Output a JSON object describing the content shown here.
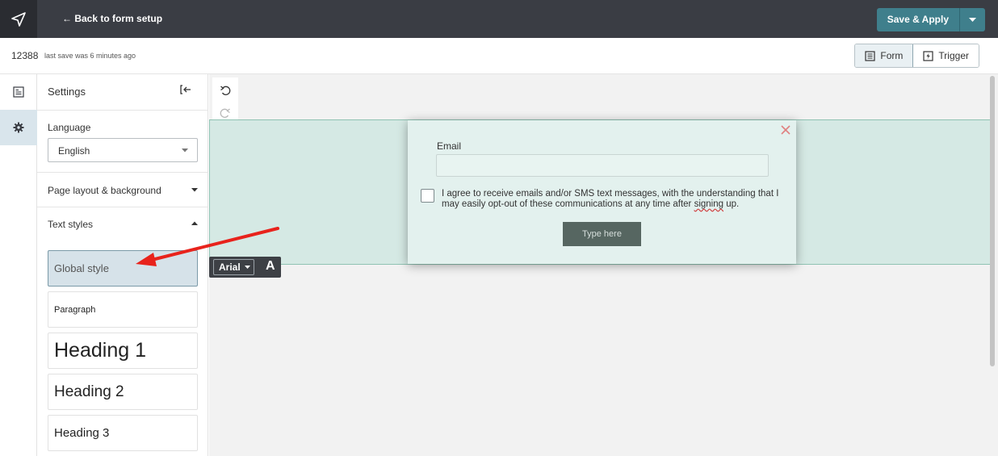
{
  "topbar": {
    "logo_icon": "paper-plane-icon",
    "back_label": "← Back to form setup",
    "save_label": "Save & Apply",
    "save_color": "#3f7f8c"
  },
  "status": {
    "form_id": "12388",
    "save_note": "last save was 6 minutes ago",
    "toggle": [
      {
        "label": "Form",
        "icon": "form-icon",
        "active": true
      },
      {
        "label": "Trigger",
        "icon": "trigger-icon",
        "active": false
      }
    ]
  },
  "rail": {
    "items": [
      {
        "icon": "form-list-icon",
        "active": false
      },
      {
        "icon": "gear-icon",
        "active": true
      }
    ]
  },
  "settings": {
    "title": "Settings",
    "language_label": "Language",
    "language_value": "English",
    "page_layout_label": "Page layout & background",
    "text_styles_label": "Text styles",
    "styles": [
      {
        "label": "Global style",
        "selected": true
      },
      {
        "label": "Paragraph",
        "selected": false
      },
      {
        "label": "Heading 1",
        "selected": false
      },
      {
        "label": "Heading 2",
        "selected": false
      },
      {
        "label": "Heading 3",
        "selected": false
      }
    ]
  },
  "form": {
    "email_label": "Email",
    "consent_text_a": "I agree to receive emails and/or SMS text messages, with the understanding that I may easily opt-out of these communications at any time after ",
    "consent_text_b": "signing",
    "consent_text_c": " up.",
    "submit_label": "Type here"
  },
  "font_toolbar": {
    "font_value": "Arial",
    "text_icon_label": "A"
  },
  "annotation": {
    "color": "#e8231c"
  }
}
